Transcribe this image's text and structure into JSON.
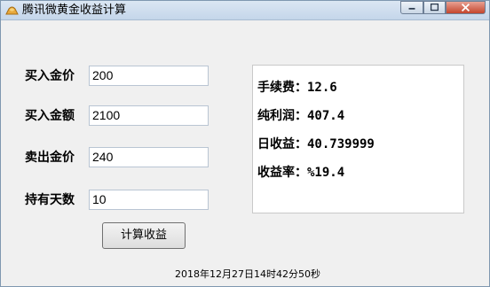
{
  "window": {
    "title": "腾讯微黄金收益计算"
  },
  "fields": [
    {
      "label": "买入金价",
      "value": "200"
    },
    {
      "label": "买入金额",
      "value": "2100"
    },
    {
      "label": "卖出金价",
      "value": "240"
    },
    {
      "label": "持有天数",
      "value": "10"
    }
  ],
  "results": {
    "fee": "手续费：12.6",
    "net_profit": "纯利润：407.4",
    "daily_income": "日收益：40.739999",
    "yield_rate": "收益率：%19.4"
  },
  "calc_button_label": "计算收益",
  "timestamp": "2018年12月27日14时42分50秒",
  "icons": {
    "app": "gold-ingot-icon",
    "minimize": "minimize-icon",
    "maximize": "maximize-icon",
    "close": "close-icon"
  }
}
